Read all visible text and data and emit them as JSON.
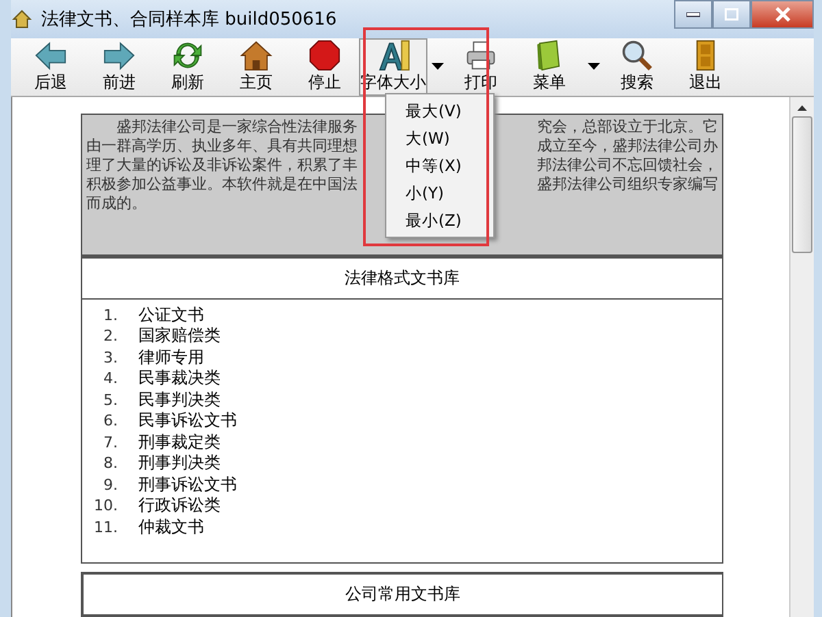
{
  "window": {
    "title": "法律文书、合同样本库 build050616"
  },
  "toolbar": [
    {
      "label": "后退",
      "dropdown": false,
      "pressed": false
    },
    {
      "label": "前进",
      "dropdown": false,
      "pressed": false
    },
    {
      "label": "刷新",
      "dropdown": false,
      "pressed": false
    },
    {
      "label": "主页",
      "dropdown": false,
      "pressed": false
    },
    {
      "label": "停止",
      "dropdown": false,
      "pressed": false
    },
    {
      "label": "字体大小",
      "dropdown": true,
      "pressed": true
    },
    {
      "label": "打印",
      "dropdown": false,
      "pressed": false
    },
    {
      "label": "菜单",
      "dropdown": true,
      "pressed": false
    },
    {
      "label": "搜索",
      "dropdown": false,
      "pressed": false
    },
    {
      "label": "退出",
      "dropdown": false,
      "pressed": false
    }
  ],
  "font_menu": {
    "items": [
      "最大(V)",
      "大(W)",
      "中等(X)",
      "小(Y)",
      "最小(Z)"
    ]
  },
  "intro_lines": [
    {
      "left": "盛邦法律公司是一家综合性法律服务",
      "right": "究会，总部设立于北京。它"
    },
    {
      "left": "由一群高学历、执业多年、具有共同理想",
      "right": "成立至今，盛邦法律公司办"
    },
    {
      "left": "理了大量的诉讼及非诉讼案件，积累了丰",
      "right": "邦法律公司不忘回馈社会，"
    },
    {
      "left": "积极参加公益事业。本软件就是在中国法",
      "right": "盛邦法律公司组织专家编写"
    },
    {
      "left": "而成的。"
    }
  ],
  "sections": [
    {
      "heading": "法律格式文书库",
      "items": [
        {
          "number": "1.",
          "label": "公证文书"
        },
        {
          "number": "2.",
          "label": "国家赔偿类"
        },
        {
          "number": "3.",
          "label": "律师专用"
        },
        {
          "number": "4.",
          "label": "民事裁决类"
        },
        {
          "number": "5.",
          "label": "民事判决类"
        },
        {
          "number": "6.",
          "label": "民事诉讼文书"
        },
        {
          "number": "7.",
          "label": "刑事裁定类"
        },
        {
          "number": "8.",
          "label": "刑事判决类"
        },
        {
          "number": "9.",
          "label": "刑事诉讼文书"
        },
        {
          "number": "10.",
          "label": "行政诉讼类"
        },
        {
          "number": "11.",
          "label": "仲裁文书"
        }
      ]
    },
    {
      "heading": "公司常用文书库"
    }
  ]
}
